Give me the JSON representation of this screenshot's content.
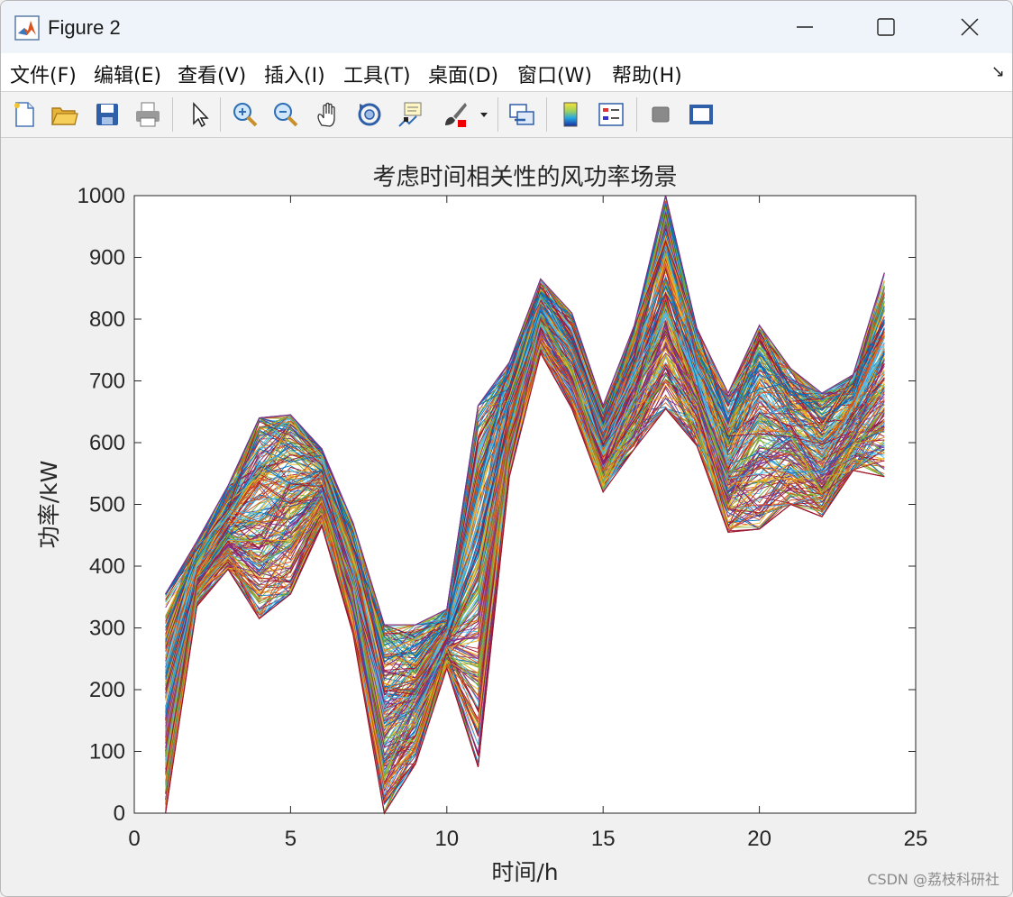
{
  "window": {
    "title": "Figure 2",
    "icon": "matlab-icon",
    "controls": [
      "minimize-icon",
      "maximize-icon",
      "close-icon"
    ]
  },
  "menu": {
    "items": [
      {
        "label": "文件(F)"
      },
      {
        "label": "编辑(E)"
      },
      {
        "label": "查看(V)"
      },
      {
        "label": "插入(I)"
      },
      {
        "label": "工具(T)"
      },
      {
        "label": "桌面(D)"
      },
      {
        "label": "窗口(W)"
      },
      {
        "label": "帮助(H)"
      }
    ],
    "dock_icon": "↘"
  },
  "toolbar": {
    "buttons": [
      "new-figure-icon",
      "open-icon",
      "save-icon",
      "print-icon",
      "select-arrow-icon",
      "zoom-in-icon",
      "zoom-out-icon",
      "pan-hand-icon",
      "rotate-3d-icon",
      "data-cursor-icon",
      "brush-icon",
      "link-plot-icon",
      "colorbar-icon",
      "legend-icon",
      "hide-plot-tools-icon",
      "show-plot-tools-icon"
    ]
  },
  "chart_data": {
    "type": "line",
    "title": "考虑时间相关性的风功率场景",
    "xlabel": "时间/h",
    "ylabel": "功率/kW",
    "xlim": [
      0,
      25
    ],
    "ylim": [
      0,
      1000
    ],
    "xticks": [
      0,
      5,
      10,
      15,
      20,
      25
    ],
    "yticks": [
      0,
      100,
      200,
      300,
      400,
      500,
      600,
      700,
      800,
      900,
      1000
    ],
    "grid": false,
    "legend": "none",
    "x": [
      1,
      2,
      3,
      4,
      5,
      6,
      7,
      8,
      9,
      10,
      11,
      12,
      13,
      14,
      15,
      16,
      17,
      18,
      19,
      20,
      21,
      22,
      23,
      24
    ],
    "envelope_upper": [
      355,
      440,
      530,
      640,
      645,
      590,
      470,
      305,
      305,
      330,
      660,
      730,
      865,
      810,
      660,
      790,
      1000,
      785,
      680,
      790,
      720,
      680,
      710,
      875
    ],
    "envelope_lower": [
      0,
      335,
      395,
      315,
      355,
      465,
      290,
      0,
      80,
      235,
      75,
      545,
      745,
      655,
      520,
      590,
      655,
      595,
      455,
      460,
      500,
      480,
      555,
      545
    ],
    "series_count_note": "",
    "colors": [
      "#0072BD",
      "#D95319",
      "#EDB120",
      "#7E2F8E",
      "#77AC30",
      "#4DBEEE",
      "#A2142F"
    ]
  },
  "watermark": "CSDN @荔枝科研社"
}
